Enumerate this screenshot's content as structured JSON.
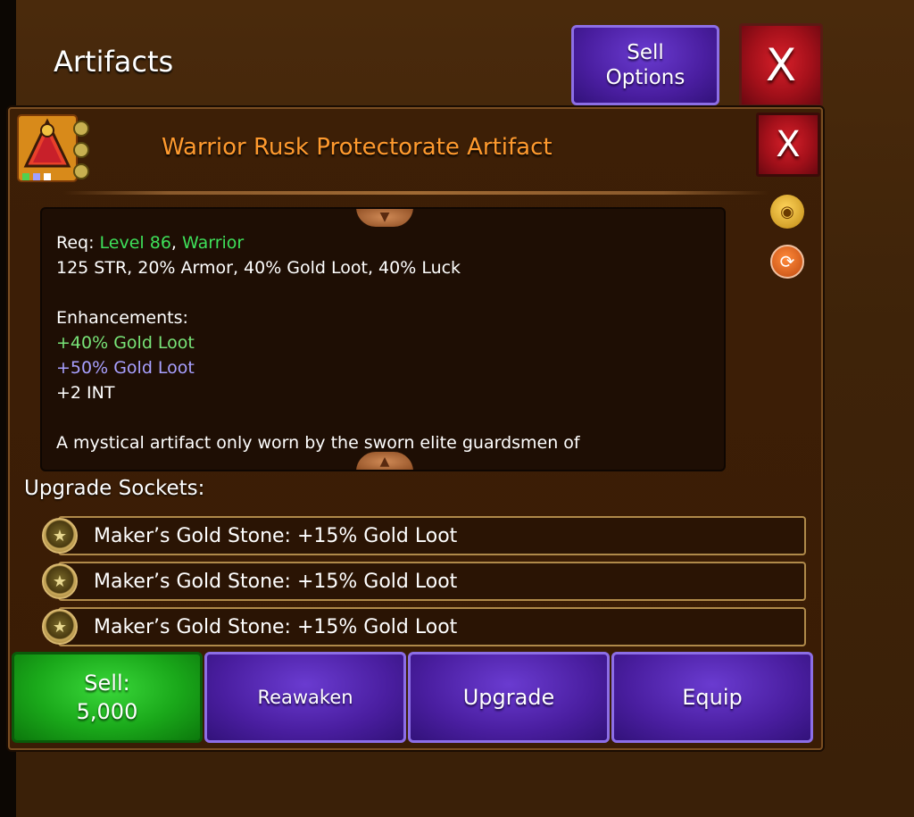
{
  "window": {
    "title": "Artifacts",
    "sell_options_label": "Sell\nOptions",
    "close_label": "X"
  },
  "item": {
    "name": "Warrior Rusk Protectorate Artifact",
    "close_label": "X",
    "icon": "artifact-pyramid-icon",
    "req_prefix": "Req: ",
    "req_level": "Level 86",
    "req_sep": ", ",
    "req_class": "Warrior",
    "stats": "125 STR, 20% Armor, 40% Gold Loot, 40% Luck",
    "enhancements_heading": "Enhancements:",
    "enhancements": [
      {
        "text": "+40% Gold Loot",
        "color": "#78e478"
      },
      {
        "text": "+50% Gold Loot",
        "color": "#a8a0ff"
      },
      {
        "text": "+2 INT",
        "color": "#ffffff"
      }
    ],
    "description": "A mystical artifact only worn by the sworn elite guardsmen of"
  },
  "side_icons": [
    "gold-bag-icon",
    "swap-icon"
  ],
  "sockets": {
    "heading": "Upgrade Sockets:",
    "items": [
      {
        "label": "Maker’s Gold Stone: +15% Gold Loot",
        "icon": "gold-stone-icon"
      },
      {
        "label": "Maker’s Gold Stone: +15% Gold Loot",
        "icon": "gold-stone-icon"
      },
      {
        "label": "Maker’s Gold Stone: +15% Gold Loot",
        "icon": "gold-stone-icon"
      }
    ]
  },
  "actions": {
    "sell_label": "Sell:",
    "sell_price": "5,000",
    "reawaken_label": "Reawaken",
    "upgrade_label": "Upgrade",
    "equip_label": "Equip"
  },
  "colors": {
    "title_orange": "#ff9a2e",
    "req_green": "#3ee05a",
    "button_purple": "#4a1ea0",
    "button_green": "#1aa81a",
    "close_red": "#a3101a"
  }
}
